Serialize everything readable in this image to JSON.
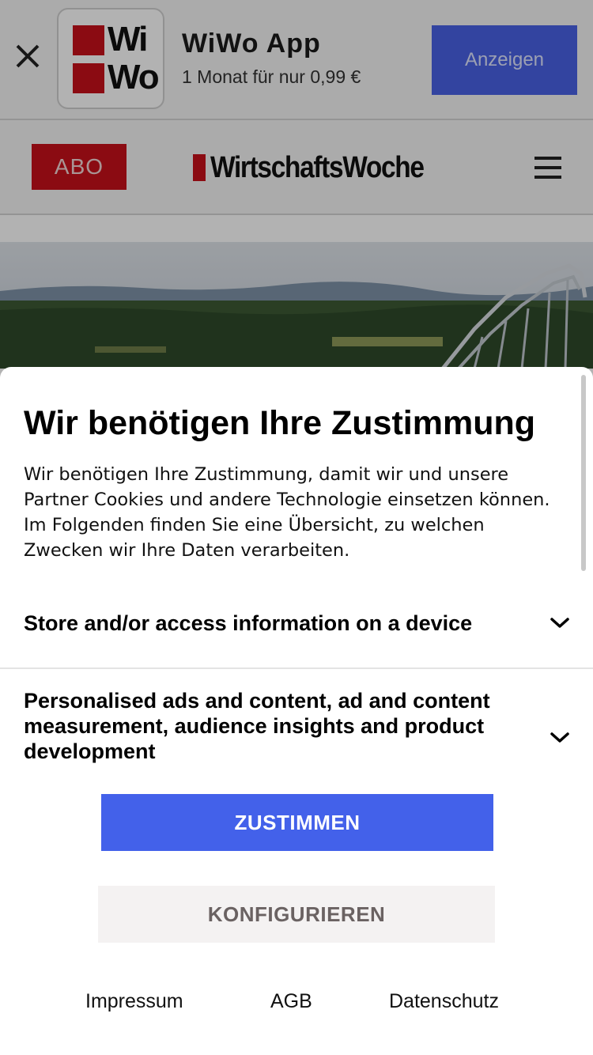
{
  "app_banner": {
    "close_icon": "close-icon",
    "icon_letters": [
      "Wi",
      "Wo"
    ],
    "app_name": "WiWo App",
    "offer": "1 Monat für nur 0,99 €",
    "cta_label": "Anzeigen",
    "cta_color": "#4a62e6"
  },
  "header": {
    "subscribe_label": "ABO",
    "logo_text": "WirtschaftsWoche",
    "menu_icon": "hamburger-menu-icon",
    "brand_color": "#c8101a"
  },
  "consent": {
    "title": "Wir benötigen Ihre Zustimmung",
    "intro": "Wir benötigen Ihre Zustimmung, damit wir und unsere Partner Cookies und andere Technologie einsetzen können. Im Folgenden finden Sie eine Übersicht, zu welchen Zwecken wir Ihre Daten verarbeiten.",
    "purposes": [
      {
        "label": "Store and/or access information on a device",
        "icon": "chevron-down-icon"
      },
      {
        "label": "Personalised ads and content, ad and content measurement, audience insights and product development",
        "icon": "chevron-down-icon"
      }
    ],
    "agree_label": "ZUSTIMMEN",
    "configure_label": "KONFIGURIEREN",
    "accent_color": "#4361ea",
    "footer_links": [
      "Impressum",
      "AGB",
      "Datenschutz"
    ]
  }
}
